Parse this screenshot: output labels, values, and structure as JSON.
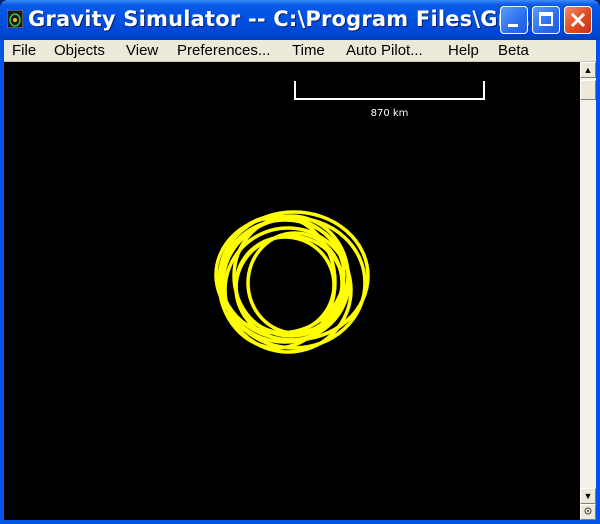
{
  "window": {
    "title": "Gravity Simulator -- C:\\Program Files\\Gra..."
  },
  "menu": {
    "items": [
      {
        "label": "File",
        "key": "file"
      },
      {
        "label": "Objects",
        "key": "objects"
      },
      {
        "label": "View",
        "key": "view"
      },
      {
        "label": "Preferences...",
        "key": "preferences"
      },
      {
        "label": "Time",
        "key": "time"
      },
      {
        "label": "Auto Pilot...",
        "key": "auto-pilot"
      },
      {
        "label": "Help",
        "key": "help"
      },
      {
        "label": "Beta",
        "key": "beta"
      }
    ]
  },
  "scale": {
    "label": "870 km"
  },
  "scrollbar": {
    "up_glyph": "▲",
    "down_glyph": "▼"
  },
  "icons": {
    "app": "gravity-app-icon",
    "minimize": "minimize-icon",
    "maximize": "maximize-icon",
    "close": "close-icon"
  },
  "colors": {
    "orbit_trail": "#ffff00",
    "canvas_bg": "#000000",
    "titlebar": "#0054e3",
    "close_button": "#e14b22"
  }
}
